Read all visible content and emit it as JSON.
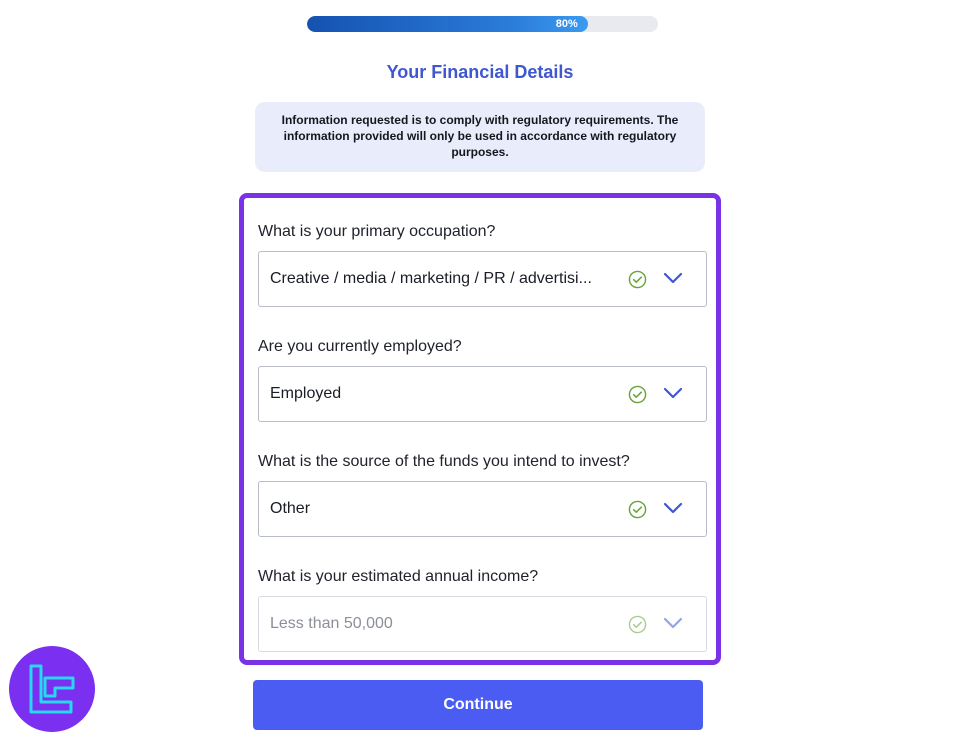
{
  "progress": {
    "percent": 80,
    "label": "80%"
  },
  "page_title": "Your Financial Details",
  "notice": "Information requested is to comply with regulatory requirements. The information provided will only be used in accordance with regulatory purposes.",
  "fields": [
    {
      "label": "What is your primary occupation?",
      "value": "Creative / media / marketing / PR / advertising",
      "display_value": "Creative / media / marketing / PR / advertisi...",
      "valid": true,
      "icon": "check-circle-icon",
      "dropdown_icon": "chevron-down-icon"
    },
    {
      "label": "Are you currently employed?",
      "value": "Employed",
      "display_value": "Employed",
      "valid": true,
      "icon": "check-circle-icon",
      "dropdown_icon": "chevron-down-icon"
    },
    {
      "label": "What is the source of the funds you intend to invest?",
      "value": "Other",
      "display_value": "Other",
      "valid": true,
      "icon": "check-circle-icon",
      "dropdown_icon": "chevron-down-icon"
    },
    {
      "label": "What is your estimated annual income?",
      "value": "Less than 50,000",
      "display_value": "Less than 50,000",
      "valid": true,
      "icon": "check-circle-icon",
      "dropdown_icon": "chevron-down-icon"
    }
  ],
  "continue_label": "Continue",
  "colors": {
    "accent": "#4a5cf2",
    "title": "#3f57cf",
    "highlight_frame": "#7a32e6",
    "valid_check": "#6aa338",
    "chevron": "#3f57cf",
    "logo_bg": "#7b2ff0",
    "logo_mark": "#27d8f0"
  }
}
